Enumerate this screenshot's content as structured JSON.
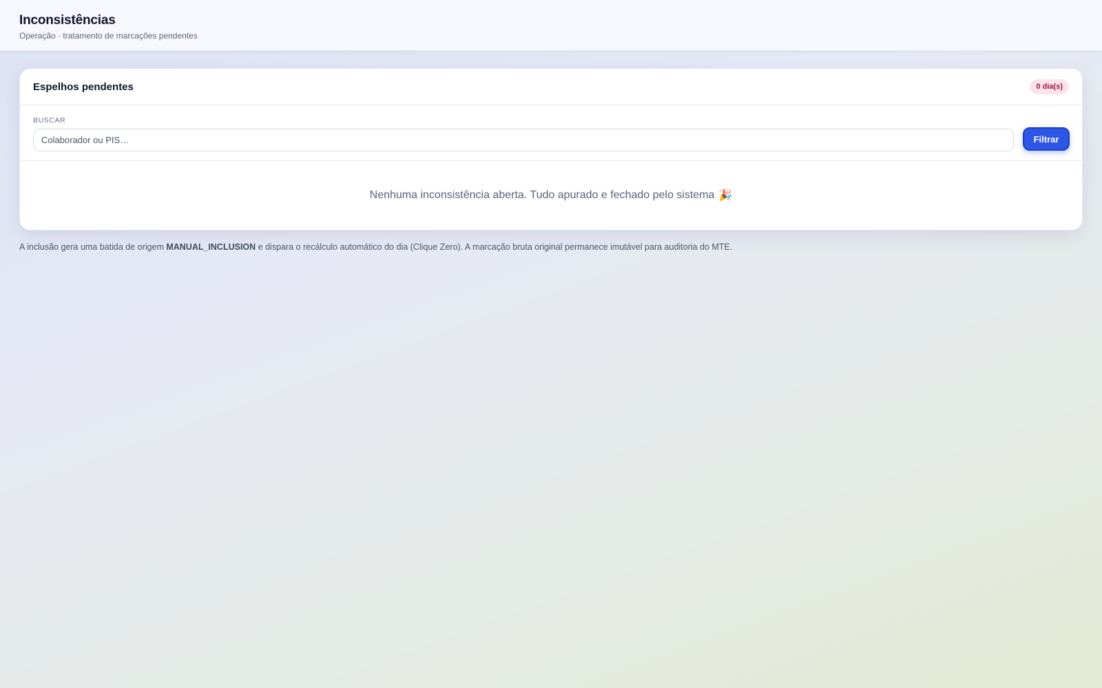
{
  "header": {
    "title": "Inconsistências",
    "subtitle": "Operação · tratamento de marcações pendentes"
  },
  "card": {
    "title": "Espelhos pendentes",
    "badge": "0 dia(s)",
    "search": {
      "label": "BUSCAR",
      "placeholder": "Colaborador ou PIS…",
      "value": ""
    },
    "filter_button": "Filtrar",
    "empty_message": "Nenhuma inconsistência aberta. Tudo apurado e fechado pelo sistema",
    "empty_icon": "🎉"
  },
  "footnote": {
    "before": "A inclusão gera uma batida de origem ",
    "highlight": "MANUAL_INCLUSION",
    "after": " e dispara o recálculo automático do dia (Clique Zero). A marcação bruta original permanece imutável para auditoria do MTE."
  },
  "colors": {
    "accent": "#2d55e6",
    "badge_bg": "#fde4ec",
    "badge_text": "#9f1239"
  }
}
